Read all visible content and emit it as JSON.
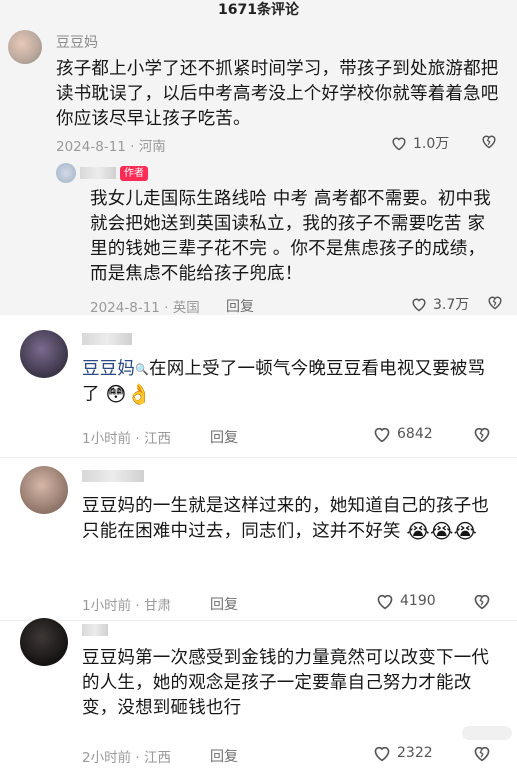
{
  "header": {
    "title": "1671条评论"
  },
  "comments": [
    {
      "username": "豆豆妈",
      "text": "孩子都上小学了还不抓紧时间学习，带孩子到处旅游都把读书耽误了，以后中考高考没上个好学校你就等着着急吧 你应该尽早让孩子吃苦。",
      "date": "2024-8-11",
      "location": "河南",
      "likes": "1.0万",
      "reply": {
        "badge": "作者",
        "text": "我女儿走国际生路线哈 中考 高考都不需要。初中我就会把她送到英国读私立，我的孩子不需要吃苦 家里的钱她三辈子花不完 。你不是焦虑孩子的成绩，而是焦虑不能给孩子兜底！",
        "date": "2024-8-11",
        "location": "英国",
        "reply_label": "回复",
        "likes": "3.7万"
      }
    },
    {
      "mention": "豆豆妈",
      "text": "在网上受了一顿气今晚豆豆看电视又要被骂了",
      "emojis": "😳👌",
      "time": "1小时前",
      "location": "江西",
      "reply_label": "回复",
      "likes": "6842"
    },
    {
      "text": "豆豆妈的一生就是这样过来的，她知道自己的孩子也只能在困难中过去，同志们，这并不好笑",
      "emojis": "😭😭😭",
      "time": "1小时前",
      "location": "甘肃",
      "reply_label": "回复",
      "likes": "4190"
    },
    {
      "text": "豆豆妈第一次感受到金钱的力量竟然可以改变下一代的人生，她的观念是孩子一定要靠自己努力才能改变，没想到砸钱也行",
      "time": "2小时前",
      "location": "江西",
      "reply_label": "回复",
      "likes": "2322"
    }
  ],
  "separator": "·",
  "icons": {
    "like": "heart-outline-icon",
    "dislike": "broken-heart-icon"
  },
  "colors": {
    "mention": "#2b4a83",
    "author_badge": "#fe2c55",
    "panel": "#f4f4f4"
  }
}
